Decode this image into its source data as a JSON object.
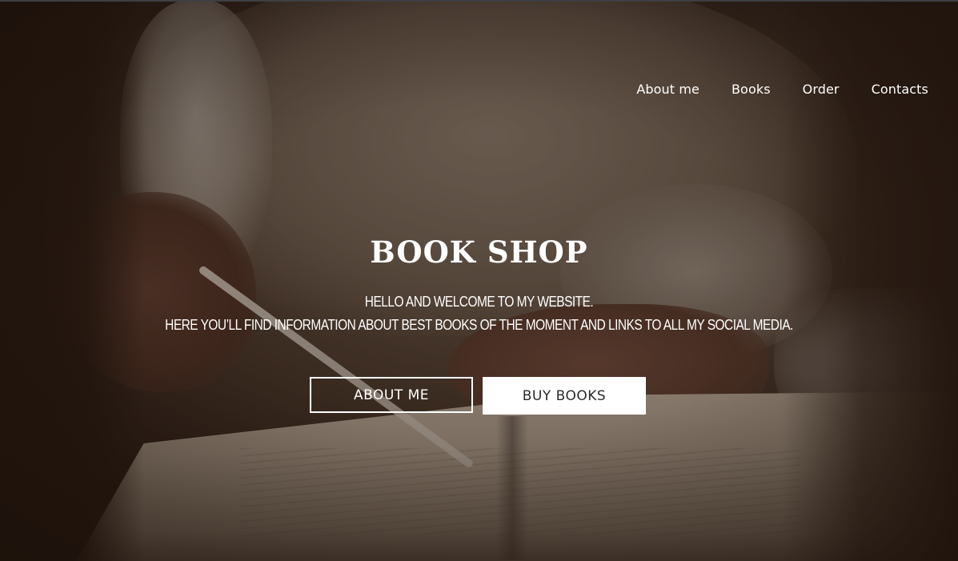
{
  "nav": {
    "items": [
      {
        "label": "About me"
      },
      {
        "label": "Books"
      },
      {
        "label": "Order"
      },
      {
        "label": "Contacts"
      }
    ]
  },
  "hero": {
    "title": "BOOK SHOP",
    "subtitle_line1": "HELLO AND WELCOME TO MY WEBSITE.",
    "subtitle_line2": "HERE YOU’LL FIND INFORMATION ABOUT BEST BOOKS OF THE MOMENT AND LINKS TO ALL MY SOCIAL MEDIA.",
    "about_button": "ABOUT ME",
    "buy_button": "BUY BOOKS"
  },
  "colors": {
    "text": "#ffffff",
    "solid_button_text": "#2b2b2b",
    "background": "#3a2a21"
  }
}
